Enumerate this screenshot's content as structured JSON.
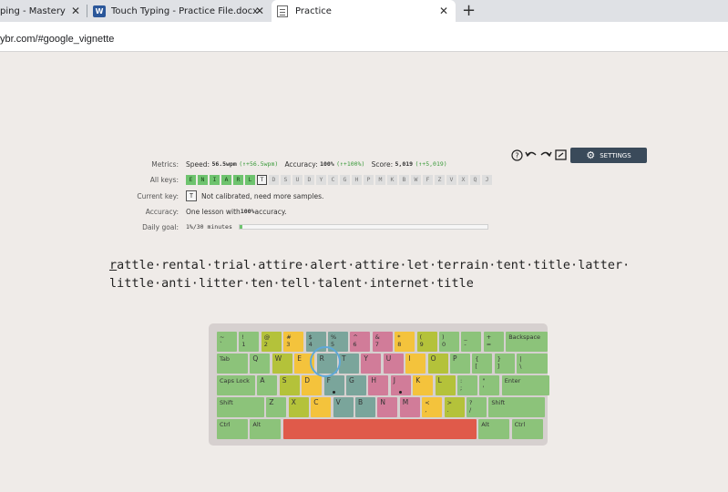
{
  "browser": {
    "tabs": [
      {
        "title": "ping - Mastery C",
        "active": false
      },
      {
        "title": "Touch Typing - Practice File.docx",
        "active": false
      },
      {
        "title": "Practice",
        "active": true
      }
    ],
    "url": "ybr.com/#google_vignette"
  },
  "metrics": {
    "metrics_label": "Metrics:",
    "speed_label": "Speed:",
    "speed_value": "56.5wpm",
    "speed_delta": "(↑+56.5wpm)",
    "accuracy_label": "Accuracy:",
    "accuracy_value": "100%",
    "accuracy_delta": "(↑+100%)",
    "score_label": "Score:",
    "score_value": "5,019",
    "score_delta": "(↑+5,019)",
    "all_keys_label": "All keys:",
    "keys": [
      "E",
      "N",
      "I",
      "A",
      "R",
      "L",
      "T",
      "D",
      "S",
      "U",
      "D",
      "Y",
      "C",
      "G",
      "H",
      "P",
      "M",
      "K",
      "B",
      "W",
      "F",
      "Z",
      "V",
      "X",
      "Q",
      "J"
    ],
    "keys_state_on_count": 6,
    "current_key_index": 6,
    "current_key_label": "Current key:",
    "current_key": "T",
    "current_key_note": "Not calibrated, need more samples.",
    "accuracy2_label": "Accuracy:",
    "accuracy2_prefix": "One lesson with ",
    "accuracy2_value": "100%",
    "accuracy2_suffix": " accuracy.",
    "daily_goal_label": "Daily goal:",
    "daily_goal_value": "1%/30 minutes",
    "daily_goal_progress": 0.01
  },
  "toolbar": {
    "help_icon": "help-icon",
    "undo_icon": "undo-icon",
    "redo_icon": "redo-icon",
    "fullscreen_icon": "fullscreen-icon",
    "settings_label": "SETTINGS"
  },
  "text": {
    "line1_first": "r",
    "line1_rest": "attle·rental·trial·attire·alert·attire·let·terrain·tent·title·latter·",
    "line2": "little·anti·litter·ten·tell·talent·internet·title"
  },
  "keyboard": {
    "row1": [
      {
        "top": "~",
        "bot": "`",
        "c": "green"
      },
      {
        "top": "!",
        "bot": "1",
        "c": "green"
      },
      {
        "top": "@",
        "bot": "2",
        "c": "olive"
      },
      {
        "top": "#",
        "bot": "3",
        "c": "yellow"
      },
      {
        "top": "$",
        "bot": "4",
        "c": "teal"
      },
      {
        "top": "%",
        "bot": "5",
        "c": "teal"
      },
      {
        "top": "^",
        "bot": "6",
        "c": "pink"
      },
      {
        "top": "&",
        "bot": "7",
        "c": "pink"
      },
      {
        "top": "*",
        "bot": "8",
        "c": "yellow"
      },
      {
        "top": "(",
        "bot": "9",
        "c": "olive"
      },
      {
        "top": ")",
        "bot": "0",
        "c": "green"
      },
      {
        "top": "_",
        "bot": "-",
        "c": "green"
      },
      {
        "top": "+",
        "bot": "=",
        "c": "green"
      },
      {
        "top": "Backspace",
        "bot": "",
        "c": "green"
      }
    ],
    "row2": [
      {
        "top": "Tab",
        "bot": "",
        "c": "green"
      },
      {
        "top": "Q",
        "bot": "",
        "c": "green"
      },
      {
        "top": "W",
        "bot": "",
        "c": "olive"
      },
      {
        "top": "E",
        "bot": "",
        "c": "yellow"
      },
      {
        "top": "R",
        "bot": "",
        "c": "teal"
      },
      {
        "top": "T",
        "bot": "",
        "c": "teal"
      },
      {
        "top": "Y",
        "bot": "",
        "c": "pink"
      },
      {
        "top": "U",
        "bot": "",
        "c": "pink"
      },
      {
        "top": "I",
        "bot": "",
        "c": "yellow"
      },
      {
        "top": "O",
        "bot": "",
        "c": "olive"
      },
      {
        "top": "P",
        "bot": "",
        "c": "green"
      },
      {
        "top": "{",
        "bot": "[",
        "c": "green"
      },
      {
        "top": "}",
        "bot": "]",
        "c": "green"
      },
      {
        "top": "|",
        "bot": "\\",
        "c": "green"
      }
    ],
    "row3": [
      {
        "top": "Caps Lock",
        "bot": "",
        "c": "green"
      },
      {
        "top": "A",
        "bot": "",
        "c": "green"
      },
      {
        "top": "S",
        "bot": "",
        "c": "olive"
      },
      {
        "top": "D",
        "bot": "",
        "c": "yellow"
      },
      {
        "top": "F",
        "bot": "",
        "c": "teal"
      },
      {
        "top": "G",
        "bot": "",
        "c": "teal"
      },
      {
        "top": "H",
        "bot": "",
        "c": "pink"
      },
      {
        "top": "J",
        "bot": "",
        "c": "pink"
      },
      {
        "top": "K",
        "bot": "",
        "c": "yellow"
      },
      {
        "top": "L",
        "bot": "",
        "c": "olive"
      },
      {
        "top": ":",
        "bot": ";",
        "c": "green"
      },
      {
        "top": "\"",
        "bot": "'",
        "c": "green"
      },
      {
        "top": "Enter",
        "bot": "",
        "c": "green"
      }
    ],
    "row4": [
      {
        "top": "Shift",
        "bot": "",
        "c": "green"
      },
      {
        "top": "Z",
        "bot": "",
        "c": "green"
      },
      {
        "top": "X",
        "bot": "",
        "c": "olive"
      },
      {
        "top": "C",
        "bot": "",
        "c": "yellow"
      },
      {
        "top": "V",
        "bot": "",
        "c": "teal"
      },
      {
        "top": "B",
        "bot": "",
        "c": "teal"
      },
      {
        "top": "N",
        "bot": "",
        "c": "pink"
      },
      {
        "top": "M",
        "bot": "",
        "c": "pink"
      },
      {
        "top": "<",
        "bot": ",",
        "c": "yellow"
      },
      {
        "top": ">",
        "bot": ".",
        "c": "olive"
      },
      {
        "top": "?",
        "bot": "/",
        "c": "green"
      },
      {
        "top": "Shift",
        "bot": "",
        "c": "green"
      }
    ],
    "row5": [
      {
        "top": "Ctrl",
        "bot": "",
        "c": "green"
      },
      {
        "top": "Alt",
        "bot": "",
        "c": "green"
      },
      {
        "top": "",
        "bot": "",
        "c": "orange"
      },
      {
        "top": "Alt",
        "bot": "",
        "c": "green"
      },
      {
        "top": "Ctrl",
        "bot": "",
        "c": "green"
      }
    ],
    "colors": {
      "green": "#8cc37a",
      "olive": "#b4c23a",
      "yellow": "#f4c33c",
      "teal": "#7aa59b",
      "pink": "#d17c99",
      "orange": "#e05a4a"
    }
  }
}
